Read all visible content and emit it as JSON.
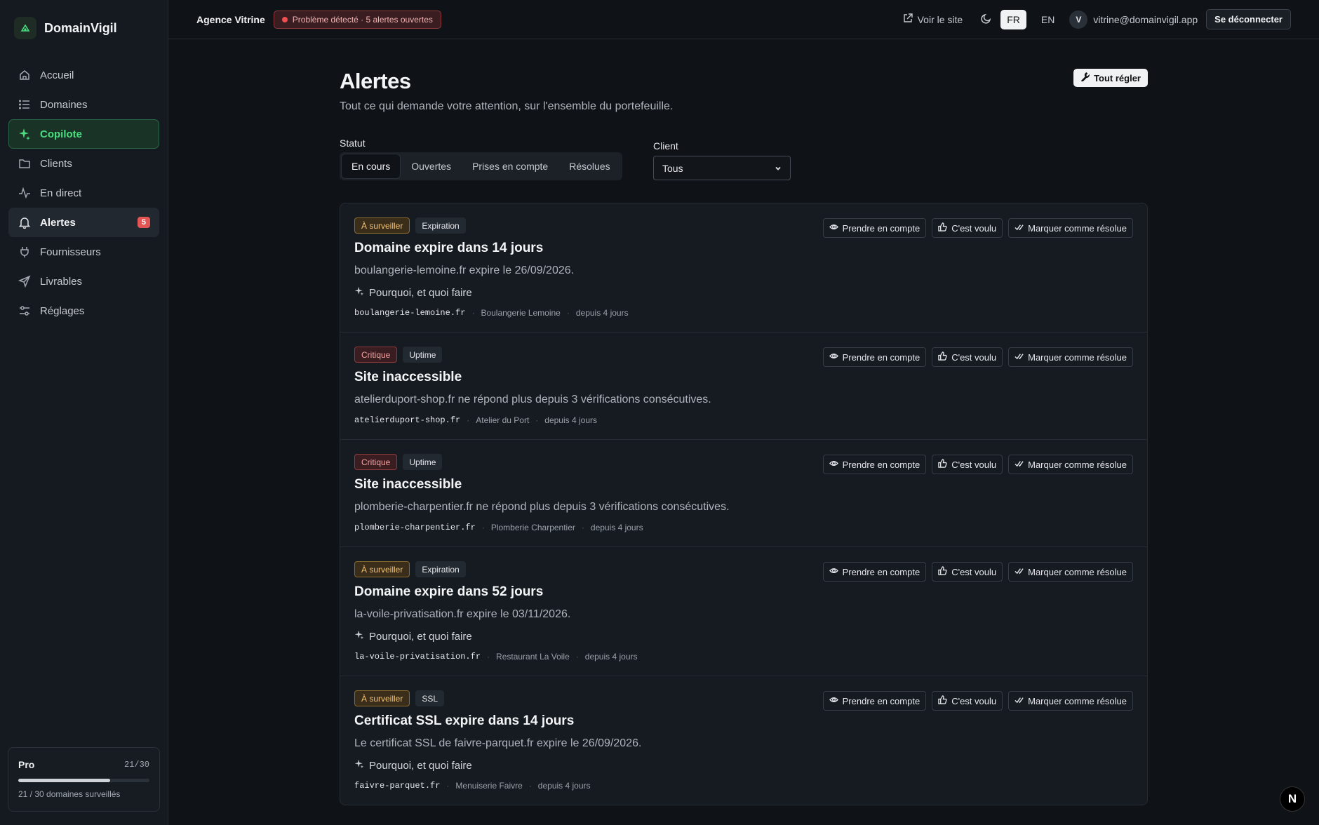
{
  "app": {
    "name": "DomainVigil"
  },
  "sidebar": {
    "items": [
      {
        "label": "Accueil",
        "icon": "home-icon"
      },
      {
        "label": "Domaines",
        "icon": "list-icon"
      },
      {
        "label": "Copilote",
        "icon": "sparkles-icon"
      },
      {
        "label": "Clients",
        "icon": "folder-icon"
      },
      {
        "label": "En direct",
        "icon": "activity-icon"
      },
      {
        "label": "Alertes",
        "icon": "bell-icon",
        "badge": "5"
      },
      {
        "label": "Fournisseurs",
        "icon": "plug-icon"
      },
      {
        "label": "Livrables",
        "icon": "send-icon"
      },
      {
        "label": "Réglages",
        "icon": "sliders-icon"
      }
    ],
    "plan": {
      "name": "Pro",
      "count": "21/30",
      "progress": 0.7,
      "text": "21 / 30 domaines surveillés"
    }
  },
  "topbar": {
    "agency": "Agence Vitrine",
    "status": "Problème détecté · 5 alertes ouvertes",
    "view_site": "Voir le site",
    "lang_fr": "FR",
    "lang_en": "EN",
    "avatar": "V",
    "email": "vitrine@domainvigil.app",
    "logout": "Se déconnecter"
  },
  "page": {
    "title": "Alertes",
    "subtitle": "Tout ce qui demande votre attention, sur l'ensemble du portefeuille.",
    "fix_all": "Tout régler"
  },
  "filters": {
    "status_label": "Statut",
    "tabs": [
      "En cours",
      "Ouvertes",
      "Prises en compte",
      "Résolues"
    ],
    "client_label": "Client",
    "client_value": "Tous"
  },
  "actions": {
    "ack": "Prendre en compte",
    "intended": "C'est voulu",
    "resolve": "Marquer comme résolue"
  },
  "why_label": "Pourquoi, et quoi faire",
  "alerts": [
    {
      "severity": "À surveiller",
      "kind": "Expiration",
      "title": "Domaine expire dans 14 jours",
      "desc": "boulangerie-lemoine.fr expire le 26/09/2026.",
      "domain": "boulangerie-lemoine.fr",
      "client": "Boulangerie Lemoine",
      "age": "depuis 4 jours"
    },
    {
      "severity": "Critique",
      "kind": "Uptime",
      "title": "Site inaccessible",
      "desc": "atelierduport-shop.fr ne répond plus depuis 3 vérifications consécutives.",
      "domain": "atelierduport-shop.fr",
      "client": "Atelier du Port",
      "age": "depuis 4 jours"
    },
    {
      "severity": "Critique",
      "kind": "Uptime",
      "title": "Site inaccessible",
      "desc": "plomberie-charpentier.fr ne répond plus depuis 3 vérifications consécutives.",
      "domain": "plomberie-charpentier.fr",
      "client": "Plomberie Charpentier",
      "age": "depuis 4 jours"
    },
    {
      "severity": "À surveiller",
      "kind": "Expiration",
      "title": "Domaine expire dans 52 jours",
      "desc": "la-voile-privatisation.fr expire le 03/11/2026.",
      "domain": "la-voile-privatisation.fr",
      "client": "Restaurant La Voile",
      "age": "depuis 4 jours"
    },
    {
      "severity": "À surveiller",
      "kind": "SSL",
      "title": "Certificat SSL expire dans 14 jours",
      "desc": "Le certificat SSL de faivre-parquet.fr expire le 26/09/2026.",
      "domain": "faivre-parquet.fr",
      "client": "Menuiserie Faivre",
      "age": "depuis 4 jours"
    }
  ],
  "dev_badge": "N"
}
